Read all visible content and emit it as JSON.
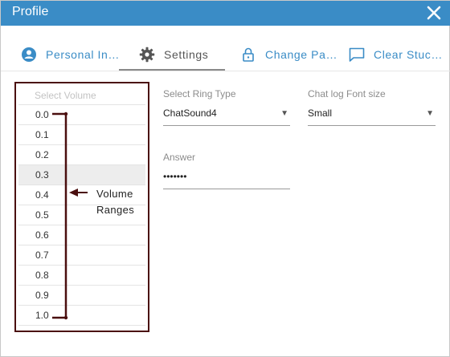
{
  "window": {
    "title": "Profile",
    "close_icon": "close-icon"
  },
  "tabs": [
    {
      "label": "Personal In…",
      "icon": "person-icon",
      "active": false
    },
    {
      "label": "Settings",
      "icon": "gear-icon",
      "active": true
    },
    {
      "label": "Change Pa…",
      "icon": "lock-icon",
      "active": false
    },
    {
      "label": "Clear Stuc…",
      "icon": "chat-icon",
      "active": false
    }
  ],
  "volume": {
    "header": "Select Volume",
    "items": [
      "0.0",
      "0.1",
      "0.2",
      "0.3",
      "0.4",
      "0.5",
      "0.6",
      "0.7",
      "0.8",
      "0.9",
      "1.0"
    ],
    "highlighted": "0.3"
  },
  "annotation": {
    "line1": "Volume",
    "line2": "Ranges",
    "color": "#4a0f0f"
  },
  "settings": {
    "ring_type_label": "Select Ring Type",
    "ring_type_value": "ChatSound4",
    "font_size_label": "Chat log Font size",
    "font_size_value": "Small",
    "answer_label": "Answer",
    "answer_value": "•••••••"
  },
  "colors": {
    "titlebar": "#3a8cc6",
    "accent": "#3a8cc6"
  }
}
